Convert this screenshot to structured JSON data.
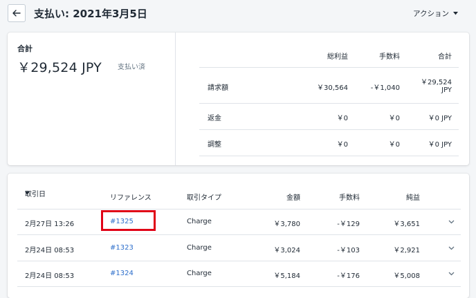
{
  "header": {
    "title": "支払い: 2021年3月5日",
    "actions_label": "アクション"
  },
  "summary": {
    "total_label": "合計",
    "total_amount": "￥29,524 JPY",
    "status": "支払い済",
    "columns": {
      "gross": "総利益",
      "fee": "手数料",
      "total": "合計"
    },
    "rows": [
      {
        "label": "請求額",
        "gross": "￥30,564",
        "fee": "-￥1,040",
        "total_line1": "￥29,524",
        "total_line2": "JPY"
      },
      {
        "label": "返金",
        "gross": "￥0",
        "fee": "￥0",
        "total_line1": "￥0 JPY",
        "total_line2": ""
      },
      {
        "label": "調整",
        "gross": "￥0",
        "fee": "￥0",
        "total_line1": "￥0 JPY",
        "total_line2": ""
      }
    ]
  },
  "transactions": {
    "columns": {
      "date": "取引日",
      "reference": "リファレンス",
      "type": "取引タイプ",
      "amount": "金額",
      "fee": "手数料",
      "net": "純益"
    },
    "rows": [
      {
        "date": "2月27日 13:26",
        "reference": "#1325",
        "type": "Charge",
        "amount": "￥3,780",
        "fee": "-￥129",
        "net": "￥3,651"
      },
      {
        "date": "2月24日 08:53",
        "reference": "#1323",
        "type": "Charge",
        "amount": "￥3,024",
        "fee": "-￥103",
        "net": "￥2,921"
      },
      {
        "date": "2月24日 08:53",
        "reference": "#1324",
        "type": "Charge",
        "amount": "￥5,184",
        "fee": "-￥176",
        "net": "￥5,008"
      }
    ]
  },
  "colors": {
    "link": "#2c6ecb",
    "highlight": "#e00016"
  }
}
